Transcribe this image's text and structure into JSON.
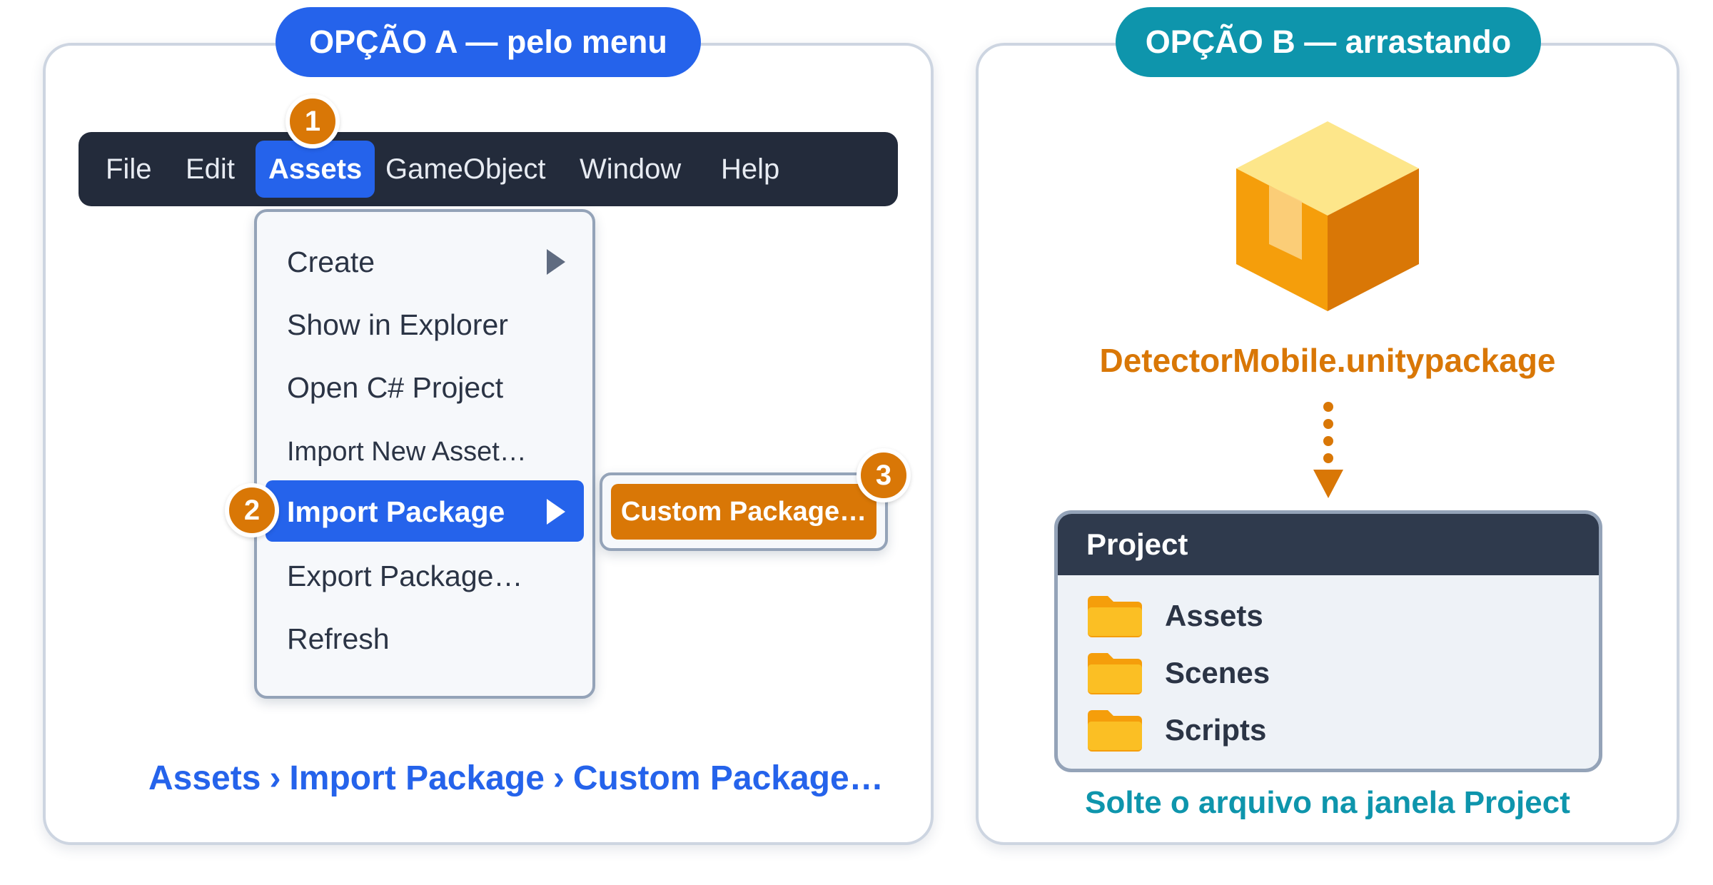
{
  "option_a": {
    "title": "OPÇÃO A — pelo menu",
    "menu_bar": [
      "File",
      "Edit",
      "Assets",
      "GameObject",
      "Window",
      "Help"
    ],
    "dropdown": [
      "Create",
      "Show in Explorer",
      "Open C# Project",
      "Import New Asset…",
      "Import Package",
      "Export Package…",
      "Refresh"
    ],
    "submenu_item": "Custom Package…",
    "steps": [
      "1",
      "2",
      "3"
    ],
    "breadcrumb": [
      "Assets",
      "Import Package",
      "Custom Package…"
    ],
    "breadcrumb_separator": "›"
  },
  "option_b": {
    "title": "OPÇÃO B — arrastando",
    "package_name": "DetectorMobile.unitypackage",
    "project_window": {
      "title": "Project",
      "folders": [
        "Assets",
        "Scenes",
        "Scripts"
      ]
    },
    "caption": "Solte o arquivo na janela Project"
  },
  "colors": {
    "blue": "#2563eb",
    "teal": "#0e95ac",
    "orange": "#d97706",
    "dark": "#232b3b"
  },
  "icons": {
    "package": "package-box-icon",
    "folder": "folder-icon",
    "arrow": "dotted-arrow-down-icon",
    "submenu": "submenu-arrow-icon"
  }
}
